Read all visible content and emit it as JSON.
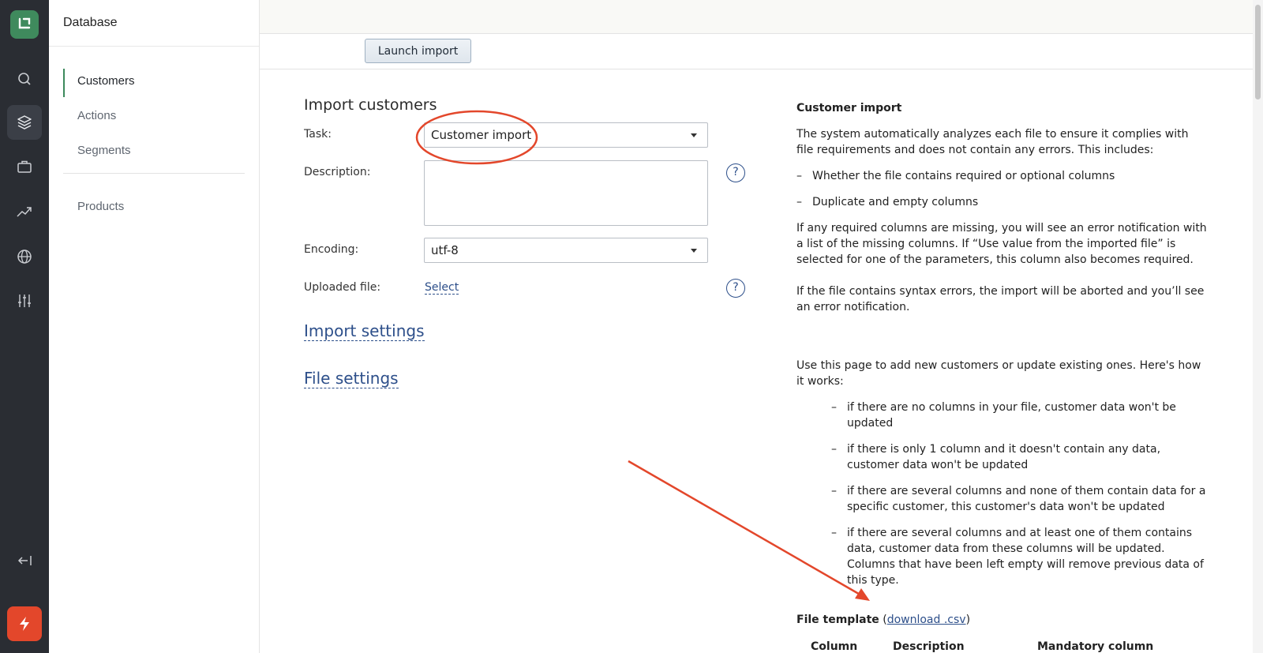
{
  "rail": {
    "icons": [
      "logo-icon",
      "search-icon",
      "layers-icon",
      "briefcase-icon",
      "trend-icon",
      "globe-icon",
      "sliders-icon",
      "collapse-icon",
      "bolt-icon"
    ]
  },
  "sidebar": {
    "title": "Database",
    "items": [
      {
        "label": "Customers",
        "active": true
      },
      {
        "label": "Actions"
      },
      {
        "label": "Segments"
      },
      {
        "label": "Products"
      }
    ]
  },
  "toolbar": {
    "launch_label": "Launch import"
  },
  "form": {
    "title": "Import customers",
    "task_label": "Task:",
    "task_value": "Customer import",
    "description_label": "Description:",
    "description_value": "",
    "encoding_label": "Encoding:",
    "encoding_value": "utf-8",
    "file_label": "Uploaded file:",
    "file_link": "Select",
    "help_glyph": "?",
    "import_settings": "Import settings",
    "file_settings": "File settings"
  },
  "info": {
    "title": "Customer import",
    "p1": "The system automatically analyzes each file to ensure it complies with file requirements and does not contain any errors. This includes:",
    "list1": [
      "Whether the file contains required or optional columns",
      "Duplicate and empty columns"
    ],
    "p2": "If any required columns are missing, you will see an error notification with a list of the missing columns. If “Use value from the imported file” is selected for one of the parameters, this column also becomes required.",
    "p3": "If the file contains syntax errors, the import will be aborted and you’ll see an error notification.",
    "p4": "Use this page to add new customers or update existing ones. Here's how it works:",
    "list2": [
      "if there are no columns in your file, customer data won't be updated",
      "if there is only 1 column and it doesn't contain any data, customer data won't be updated",
      "if there are several columns and none of them contain data for a specific customer, this customer's data won't be updated",
      "if there are several columns and at least one of them contains data, customer data from these columns will be updated. Columns that have been left empty will remove previous data of this type."
    ],
    "template_label": "File template",
    "template_open": " (",
    "template_link": "download .csv",
    "template_close": ")",
    "columns": [
      "Column",
      "Description",
      "Mandatory column"
    ]
  },
  "colors": {
    "rail": "#2a2d33",
    "brand": "#3f8a5d",
    "accent_link": "#2d4f8a",
    "annotation": "#e3472b"
  }
}
